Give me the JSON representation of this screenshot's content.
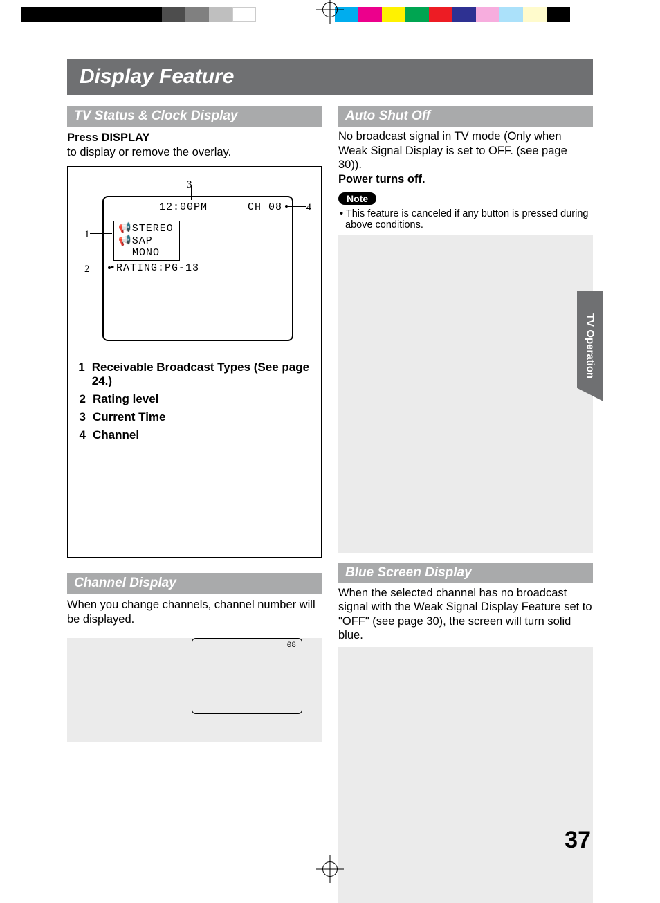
{
  "page_title": "Display Feature",
  "side_tab": "TV Operation",
  "page_number": "37",
  "left": {
    "section1_header": "TV Status & Clock Display",
    "press_line_bold": "Press DISPLAY",
    "press_line_rest": "to display or remove the overlay.",
    "tv": {
      "time": "12:00PM",
      "channel": "CH 08",
      "audio1": "STEREO",
      "audio2": "SAP",
      "audio3": "MONO",
      "rating": "RATING:PG-13"
    },
    "callouts": {
      "c1": "1",
      "c2": "2",
      "c3": "3",
      "c4": "4"
    },
    "legend": [
      {
        "n": "1",
        "t": "Receivable Broadcast Types (See page 24.)"
      },
      {
        "n": "2",
        "t": "Rating level"
      },
      {
        "n": "3",
        "t": "Current Time"
      },
      {
        "n": "4",
        "t": "Channel"
      }
    ],
    "section2_header": "Channel Display",
    "section2_body": "When you change channels, channel number will be displayed.",
    "mini_channel": "08"
  },
  "right": {
    "section1_header": "Auto Shut Off",
    "auto_body1": "No broadcast signal in TV mode (Only when Weak Signal Display is set to OFF. (see page 30)).",
    "auto_body2_bold": "Power turns off.",
    "note_label": "Note",
    "note_body": "• This feature is canceled if any button is pressed during above conditions.",
    "section2_header": "Blue Screen Display",
    "blue_body": "When the selected channel has no broadcast signal with the Weak Signal Display Feature set to \"OFF\" (see page 30), the screen will turn solid blue."
  }
}
